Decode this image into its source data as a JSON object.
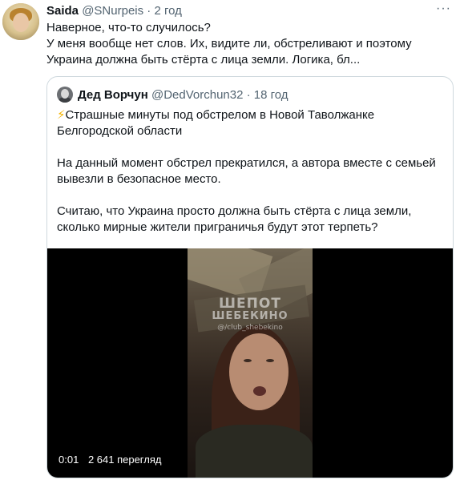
{
  "tweet": {
    "author_name": "Saida",
    "author_handle": "@SNurpeis",
    "separator": "·",
    "time": "2 год",
    "more_label": "···",
    "text_lines": [
      "Наверное, что-то случилось?",
      "У меня вообще нет слов. Их, видите ли, обстреливают и поэтому",
      "Украина должна быть стёрта с лица земли. Логика, бл..."
    ]
  },
  "quote": {
    "author_name": "Дед Ворчун",
    "author_handle": "@DedVorchun32",
    "separator": "·",
    "time": "18 год",
    "bolt": "⚡",
    "paragraph1": [
      "Страшные минуты под обстрелом в Новой Таволжанке",
      "Белгородской области"
    ],
    "paragraph2": [
      "На данный момент обстрел прекратился, а автора вместе с семьей",
      "вывезли в безопасное место."
    ],
    "paragraph3": [
      "Считаю, что Украина просто должна быть стёрта с лица земли,",
      "сколько мирные жители приграничья будут этот терпеть?"
    ],
    "video": {
      "watermark_line1": "ШЕПОТ",
      "watermark_line2": "ШЕБЕКИНО",
      "watermark_line3": "@/club_shebekino",
      "duration": "0:01",
      "views": "2 641 перегляд"
    }
  },
  "colors": {
    "text": "#0f1419",
    "secondary": "#536471",
    "border": "#cfd9de",
    "bolt": "#f4b400"
  }
}
